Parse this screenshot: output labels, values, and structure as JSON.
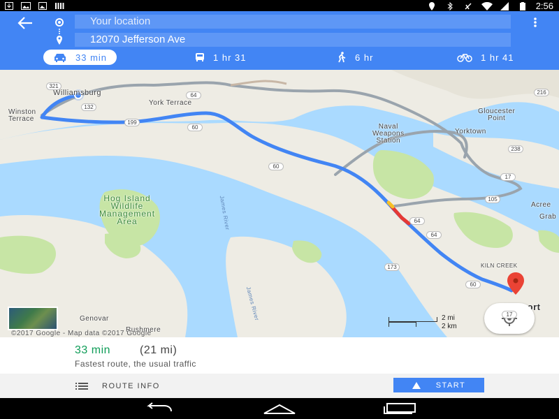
{
  "status_bar": {
    "time": "2:56"
  },
  "search": {
    "origin": "Your location",
    "destination": "12070 Jefferson Ave"
  },
  "modes": [
    {
      "name": "drive",
      "label": "33 min",
      "icon": "car-icon",
      "selected": true
    },
    {
      "name": "transit",
      "label": "1 hr 31",
      "icon": "bus-icon",
      "selected": false
    },
    {
      "name": "walk",
      "label": "6 hr",
      "icon": "walk-icon",
      "selected": false
    },
    {
      "name": "bike",
      "label": "1 hr 41",
      "icon": "bike-icon",
      "selected": false
    }
  ],
  "map": {
    "labels": {
      "williamsburg": "Williamsburg",
      "winston_terrace": "Winston\nTerrace",
      "york_terrace": "York Terrace",
      "gloucester_point": "Gloucester\nPoint",
      "naval_weapons_station": "Naval\nWeapons\nStation",
      "yorktown": "Yorktown",
      "hog_island": "Hog Island\nWildlife\nManagement\nArea",
      "acree": "Acree",
      "grab": "Grab",
      "kiln_creek": "KILN CREEK",
      "newport": "Newport",
      "genovar": "Genovar",
      "rushmere": "Rushmere",
      "james_river_1": "James River",
      "james_river_2": "James River"
    },
    "road_shields": [
      "321",
      "132",
      "64",
      "199",
      "60",
      "60",
      "216",
      "238",
      "17",
      "105",
      "64",
      "64",
      "173",
      "60",
      "17"
    ],
    "scale": {
      "miles": "2 mi",
      "km": "2 km"
    },
    "copyright": "©2017 Google - Map data ©2017 Google"
  },
  "route_card": {
    "time": "33 min",
    "distance": "(21 mi)",
    "description": "Fastest route, the usual traffic",
    "route_info_label": "ROUTE INFO",
    "start_label": "START"
  },
  "colors": {
    "header": "#4285f4",
    "route": "#4285f4",
    "alt_route": "#9aa4ad",
    "traffic": "#e53935",
    "duration_green": "#0f9d58",
    "pin": "#ea4335"
  }
}
